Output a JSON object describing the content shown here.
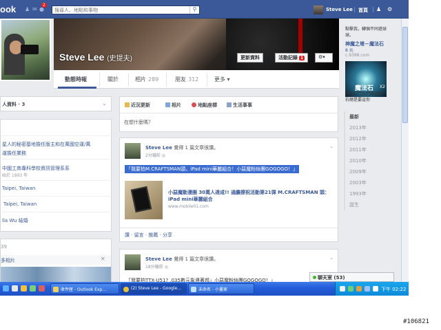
{
  "topbar": {
    "logo": "ook",
    "notif_count": "2",
    "search_placeholder": "搜尋人、地點和事物",
    "user_name": "Steve Lee",
    "home": "首頁",
    "brand_color": "#3b5998"
  },
  "profile": {
    "name": "Steve Lee",
    "alias": "(史提夫)",
    "update_info": "更新資料",
    "activity_log": "活動記錄",
    "activity_badge": "1"
  },
  "tabs": [
    {
      "label": "動態時報",
      "count": ""
    },
    {
      "label": "關於",
      "count": ""
    },
    {
      "label": "相片",
      "count": "289"
    },
    {
      "label": "朋友",
      "count": "312"
    },
    {
      "label": "更多",
      "count": ""
    }
  ],
  "left": {
    "about_title": "人資料 · 3",
    "rows": [
      {
        "text": "星人的秘密基地擔任版主和在萬國空運/萬",
        "sub": ""
      },
      {
        "text": "運擔任業務",
        "sub": ""
      },
      {
        "text": "中國工商專科學校資訊管理系系",
        "sub": ""
      },
      {
        "text": "",
        "sub": "始於 1993 年"
      },
      {
        "text": "Taipei, Taiwan",
        "sub": ""
      },
      {
        "text": "Taipei, Taiwan",
        "sub": ""
      },
      {
        "text": "lla Wu 結婚",
        "sub": ""
      }
    ],
    "photos_count": "39",
    "more_photos": "多相片"
  },
  "composer": {
    "tabs": [
      "近況更新",
      "相片",
      "地點座標",
      "生活事事"
    ],
    "placeholder": "在想什麼嗎？"
  },
  "posts": [
    {
      "author": "Steve Lee",
      "verb": "覺得 1 篇文章很讚。",
      "time": "2分鐘前",
      "highlight": "「我要拍M.CRAFTSMAN頭，iPad mini華麗組合！小惡魔粉絲團GOGOGO！」",
      "link_title": "小惡魔動漫圈 30萬人達成!! 通膽撩祝活動第21彈 M.CRAFTSMAN 頭：iPad mini華麗組合",
      "link_url": "www.mobile01.com",
      "actions": "讚 · 留言 · 推薦 · 分享"
    },
    {
      "author": "Steve Lee",
      "verb": "覺得 1 篇文章很讚。",
      "time": "18分鐘前",
      "highlight": "「我要拍TTX-U51? ,035數元象連著邦」小惡魔粉絲團GOGOGO！」",
      "link_title": "",
      "link_url": "",
      "actions": ""
    }
  ],
  "right": {
    "ad_line1": "點擊我，轉個不同遊球",
    "ad_line2": "球。",
    "ad_title": "神魔之塔－魔法石",
    "ad_sub": "8 元",
    "ad_url": "c.9388.com",
    "ad_img_title": "魔法石",
    "ad_img_x2": "X2",
    "ad_img_caption": "魔法石鬥我們讓遊戲",
    "ad_img_caption2": "石總是要這你",
    "years": [
      "最新",
      "2013年",
      "2012年",
      "2011年",
      "2010年",
      "2009年",
      "2003年",
      "1993年",
      "誕生"
    ]
  },
  "chat": {
    "label": "聊天室 (53)"
  },
  "taskbar": {
    "buttons": [
      "收件匣 - Outlook Exp...",
      "(2) Steve Lee - Google...",
      "未命名 - 小畫家"
    ],
    "clock": "下午 02:22"
  },
  "watermark": "#106821"
}
